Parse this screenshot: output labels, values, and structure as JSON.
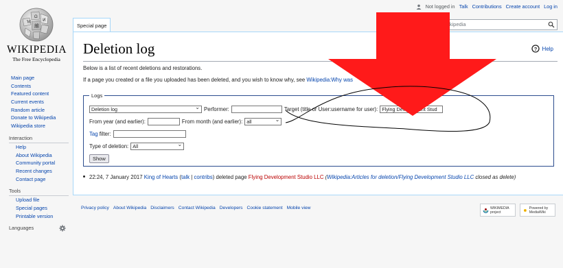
{
  "logo": {
    "wordmark": "WIKIPEDIA",
    "tagline": "The Free Encyclopedia",
    "icon": "wikipedia-globe-icon"
  },
  "personal": {
    "not_logged_in": "Not logged in",
    "talk": "Talk",
    "contributions": "Contributions",
    "create_account": "Create account",
    "log_in": "Log in",
    "icon": "user-icon"
  },
  "tab": {
    "special_page": "Special page"
  },
  "search": {
    "value": "Wikipedia",
    "icon": "search-icon"
  },
  "sidebar": {
    "nav": [
      "Main page",
      "Contents",
      "Featured content",
      "Current events",
      "Random article",
      "Donate to Wikipedia",
      "Wikipedia store"
    ],
    "interaction": {
      "heading": "Interaction",
      "items": [
        "Help",
        "About Wikipedia",
        "Community portal",
        "Recent changes",
        "Contact page"
      ]
    },
    "tools": {
      "heading": "Tools",
      "items": [
        "Upload file",
        "Special pages",
        "Printable version"
      ]
    },
    "languages": {
      "heading": "Languages",
      "icon": "gear-icon"
    }
  },
  "page": {
    "title": "Deletion log",
    "help": "Help",
    "help_icon": "help-icon",
    "intro": "Below is a list of recent deletions and restorations.",
    "deleted_prefix": "If a page you created or a file you uploaded has been deleted, and you wish to know why, see",
    "deleted_link": "Wikipedia:Why was"
  },
  "logs_form": {
    "legend": "Logs",
    "log_type": "Deletion log",
    "performer_label": "Performer:",
    "performer_value": "",
    "target_label": "Target (title or User:username for user):",
    "target_value": "Flying Development Stud",
    "from_year_label": "From year (and earlier):",
    "from_year_value": "",
    "from_month_label": "From month (and earlier):",
    "from_month_value": "all",
    "tag_link": "Tag",
    "tag_label": "filter:",
    "tag_value": "",
    "type_label": "Type of deletion:",
    "type_value": "All",
    "show_button": "Show"
  },
  "entry": {
    "timestamp": "22:24, 7 January 2017",
    "user": "King of Hearts",
    "open_paren": " (",
    "talk": "talk",
    "sep": " | ",
    "contribs": "contribs",
    "close_paren": ") deleted page ",
    "page": "Flying Development Studio LLC",
    "reason_prefix": " (",
    "reason_link": "Wikipedia:Articles for deletion/Flying Development Studio LLC",
    "reason_suffix": " closed as delete)"
  },
  "footer": {
    "links": [
      "Privacy policy",
      "About Wikipedia",
      "Disclaimers",
      "Contact Wikipedia",
      "Developers",
      "Cookie statement",
      "Mobile view"
    ],
    "badge_wikimedia": "WIKIMEDIA project",
    "badge_mediawiki": "Powered by MediaWiki"
  },
  "annotation": {
    "arrow_color": "#ff1a1a",
    "scribble_color": "#000000"
  }
}
